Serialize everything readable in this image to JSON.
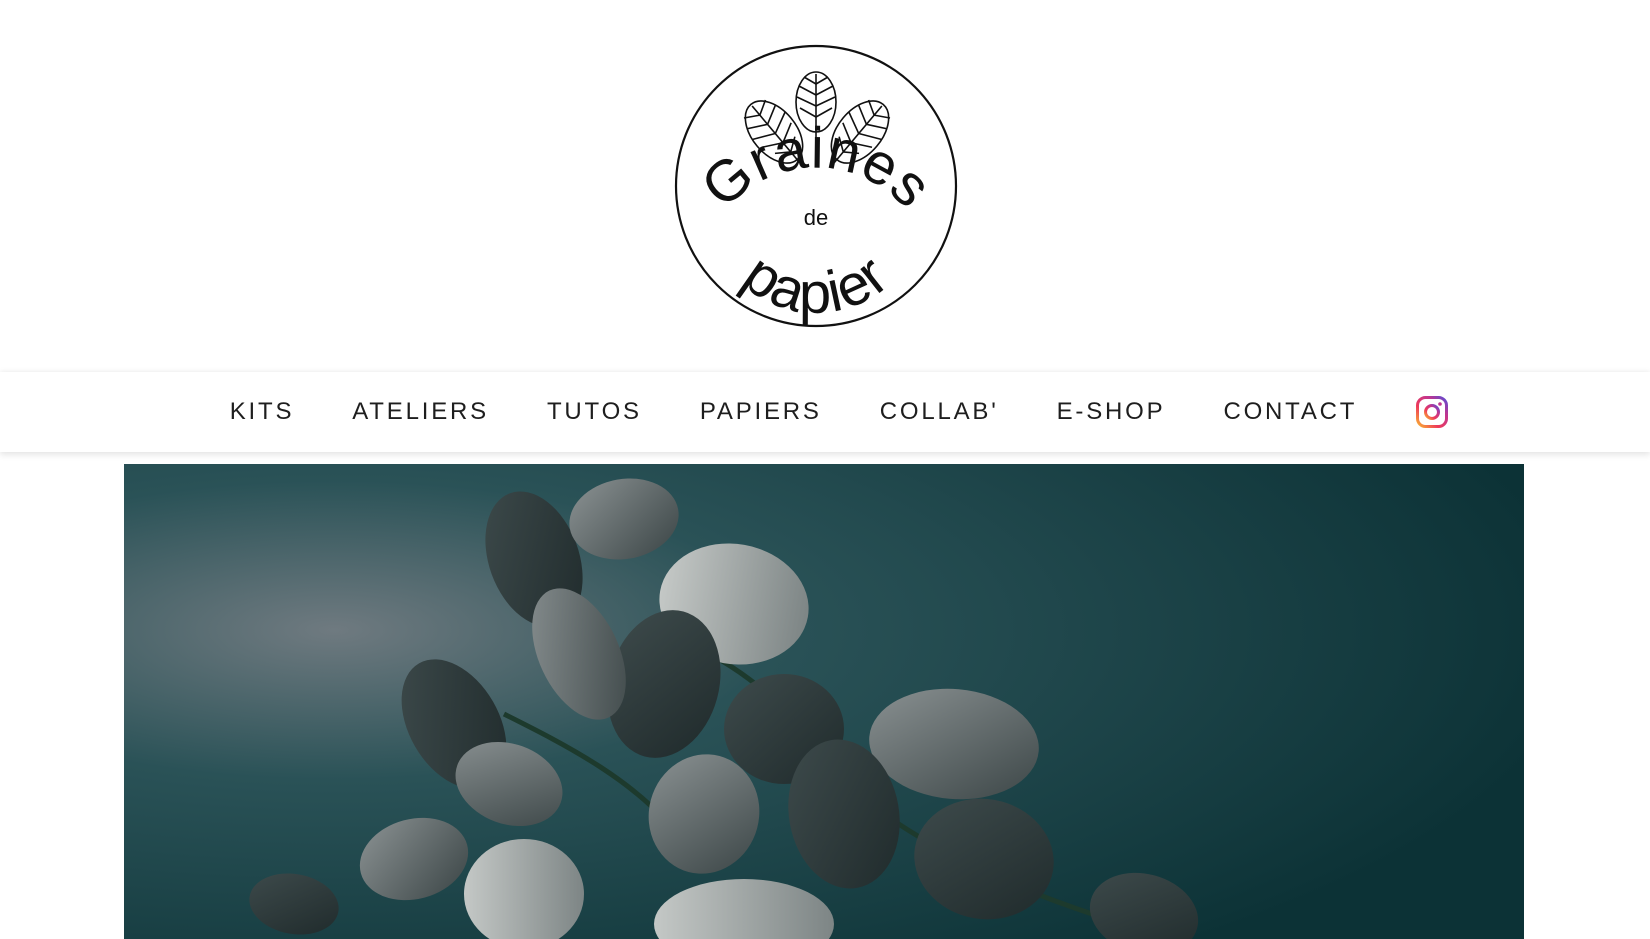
{
  "site": {
    "logo": {
      "text_line1": "Graines",
      "text_line2": "de",
      "text_line3": "papier",
      "icon": "leaf-trio-icon"
    }
  },
  "nav": {
    "items": [
      {
        "label": "KITS"
      },
      {
        "label": "ATELIERS"
      },
      {
        "label": "TUTOS"
      },
      {
        "label": "PAPIERS"
      },
      {
        "label": "COLLAB'"
      },
      {
        "label": "E-SHOP"
      },
      {
        "label": "CONTACT"
      }
    ],
    "instagram_icon": "instagram-icon"
  },
  "hero": {
    "subject": "paper-eucalyptus-branches",
    "background_color": "#0f3a3e",
    "leaf_color": "#5a6465"
  }
}
